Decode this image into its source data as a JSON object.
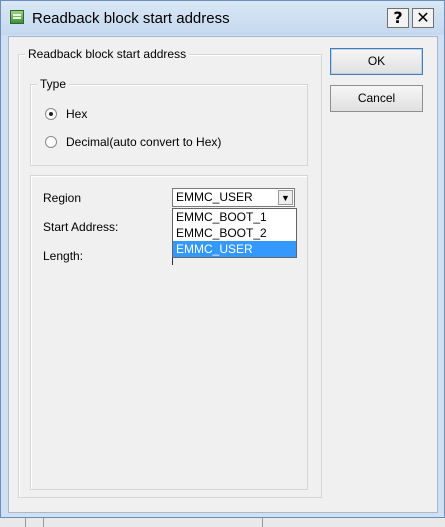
{
  "window": {
    "title": "Readback block start address",
    "help_glyph": "?",
    "close_glyph": "✕"
  },
  "outer_group": {
    "label": "Readback block start address"
  },
  "type_group": {
    "label": "Type",
    "options": [
      {
        "label": "Hex",
        "checked": true
      },
      {
        "label": "Decimal(auto convert to Hex)",
        "checked": false
      }
    ]
  },
  "fields": {
    "region_label": "Region",
    "start_address_label": "Start Address:",
    "length_label": "Length:",
    "start_address_value": "",
    "length_value": ""
  },
  "region_combo": {
    "selected": "EMMC_USER",
    "arrow_icon": "chevron-down-icon",
    "options": [
      "EMMC_BOOT_1",
      "EMMC_BOOT_2",
      "EMMC_USER"
    ],
    "highlighted": "EMMC_USER"
  },
  "buttons": {
    "ok": "OK",
    "cancel": "Cancel"
  },
  "colors": {
    "title_bar": "#cfe0f3",
    "selection": "#3399ff",
    "dialog_bg": "#f0f0f0"
  }
}
